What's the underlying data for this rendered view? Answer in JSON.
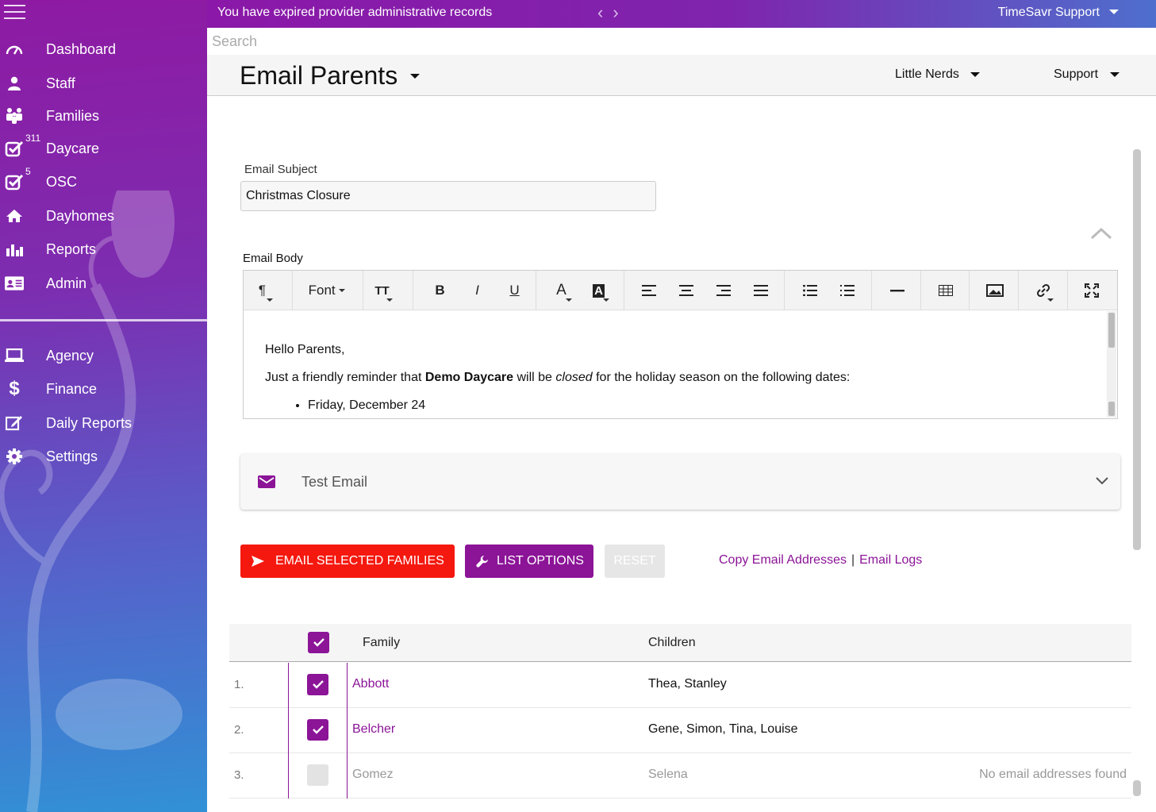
{
  "sidebar": {
    "main_items": [
      {
        "label": "Dashboard",
        "icon": "speedometer-icon"
      },
      {
        "label": "Staff",
        "icon": "person-icon"
      },
      {
        "label": "Families",
        "icon": "family-icon"
      },
      {
        "label": "Daycare",
        "icon": "checkbox-icon",
        "count": "311"
      },
      {
        "label": "OSC",
        "icon": "checkbox-icon",
        "count": "5"
      },
      {
        "label": "Dayhomes",
        "icon": "home-icon"
      },
      {
        "label": "Reports",
        "icon": "bar-chart-icon"
      },
      {
        "label": "Admin",
        "icon": "id-card-icon"
      }
    ],
    "secondary_items": [
      {
        "label": "Agency",
        "icon": "laptop-icon"
      },
      {
        "label": "Finance",
        "icon": "dollar-icon"
      },
      {
        "label": "Daily Reports",
        "icon": "edit-icon"
      },
      {
        "label": "Settings",
        "icon": "gear-icon"
      }
    ]
  },
  "topbar": {
    "alert": "You have expired provider administrative records",
    "user": "TimeSavr Support"
  },
  "search": {
    "placeholder": "Search"
  },
  "header": {
    "title": "Email Parents",
    "center_dropdown": "Little Nerds",
    "support_dropdown": "Support"
  },
  "form": {
    "subject_label": "Email Subject",
    "subject_value": "Christmas Closure",
    "body_label": "Email Body"
  },
  "toolbar": {
    "paragraph": "¶",
    "font": "Font",
    "font_size": "TT",
    "bold": "B",
    "italic": "I",
    "underline": "U",
    "font_color": "A",
    "highlight": "A"
  },
  "editor": {
    "greeting": "Hello Parents,",
    "line_prefix": "Just a friendly reminder that ",
    "line_bold": "Demo Daycare",
    "line_mid": " will be ",
    "line_italic": "closed",
    "line_suffix": " for the holiday season on the following dates:",
    "bullets": [
      "Friday, December 24"
    ]
  },
  "test_email": {
    "label": "Test Email"
  },
  "actions": {
    "email_selected": "EMAIL SELECTED FAMILIES",
    "list_options": "LIST OPTIONS",
    "reset": "RESET",
    "copy_emails": "Copy Email Addresses",
    "separator": "|",
    "email_logs": "Email Logs"
  },
  "table": {
    "headers": {
      "family": "Family",
      "children": "Children"
    },
    "rows": [
      {
        "num": "1.",
        "family": "Abbott",
        "children": "Thea, Stanley",
        "checked": true,
        "note": ""
      },
      {
        "num": "2.",
        "family": "Belcher",
        "children": "Gene, Simon, Tina, Louise",
        "checked": true,
        "note": ""
      },
      {
        "num": "3.",
        "family": "Gomez",
        "children": "Selena",
        "checked": false,
        "note": "No email addresses found"
      }
    ]
  },
  "colors": {
    "brand_purple": "#8b1497",
    "danger_red": "#f5180f",
    "sidebar_top": "#8e1aa3",
    "sidebar_bottom": "#3191d6"
  }
}
